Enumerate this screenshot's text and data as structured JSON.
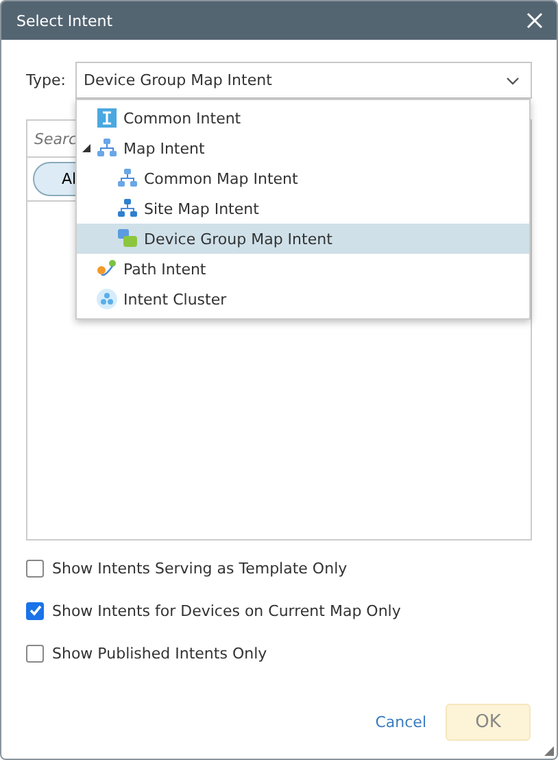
{
  "window": {
    "title": "Select Intent"
  },
  "type_field": {
    "label": "Type:",
    "value": "Device Group Map Intent"
  },
  "dropdown": {
    "items": [
      {
        "label": "Common Intent",
        "kind": "common",
        "selected": false
      },
      {
        "label": "Map Intent",
        "kind": "map",
        "selected": false,
        "expanded": true,
        "children": [
          {
            "label": "Common Map Intent",
            "kind": "map",
            "selected": false
          },
          {
            "label": "Site Map Intent",
            "kind": "site",
            "selected": false
          },
          {
            "label": "Device Group Map Intent",
            "kind": "group",
            "selected": true
          }
        ]
      },
      {
        "label": "Path Intent",
        "kind": "path",
        "selected": false
      },
      {
        "label": "Intent Cluster",
        "kind": "cluster",
        "selected": false
      }
    ]
  },
  "list_panel": {
    "search_placeholder": "Searc",
    "filter_button": "Al"
  },
  "options": [
    {
      "label": "Show Intents Serving as Template Only",
      "checked": false
    },
    {
      "label": "Show Intents for Devices on Current Map Only",
      "checked": true
    },
    {
      "label": "Show Published Intents Only",
      "checked": false
    }
  ],
  "buttons": {
    "cancel": "Cancel",
    "ok": "OK"
  }
}
